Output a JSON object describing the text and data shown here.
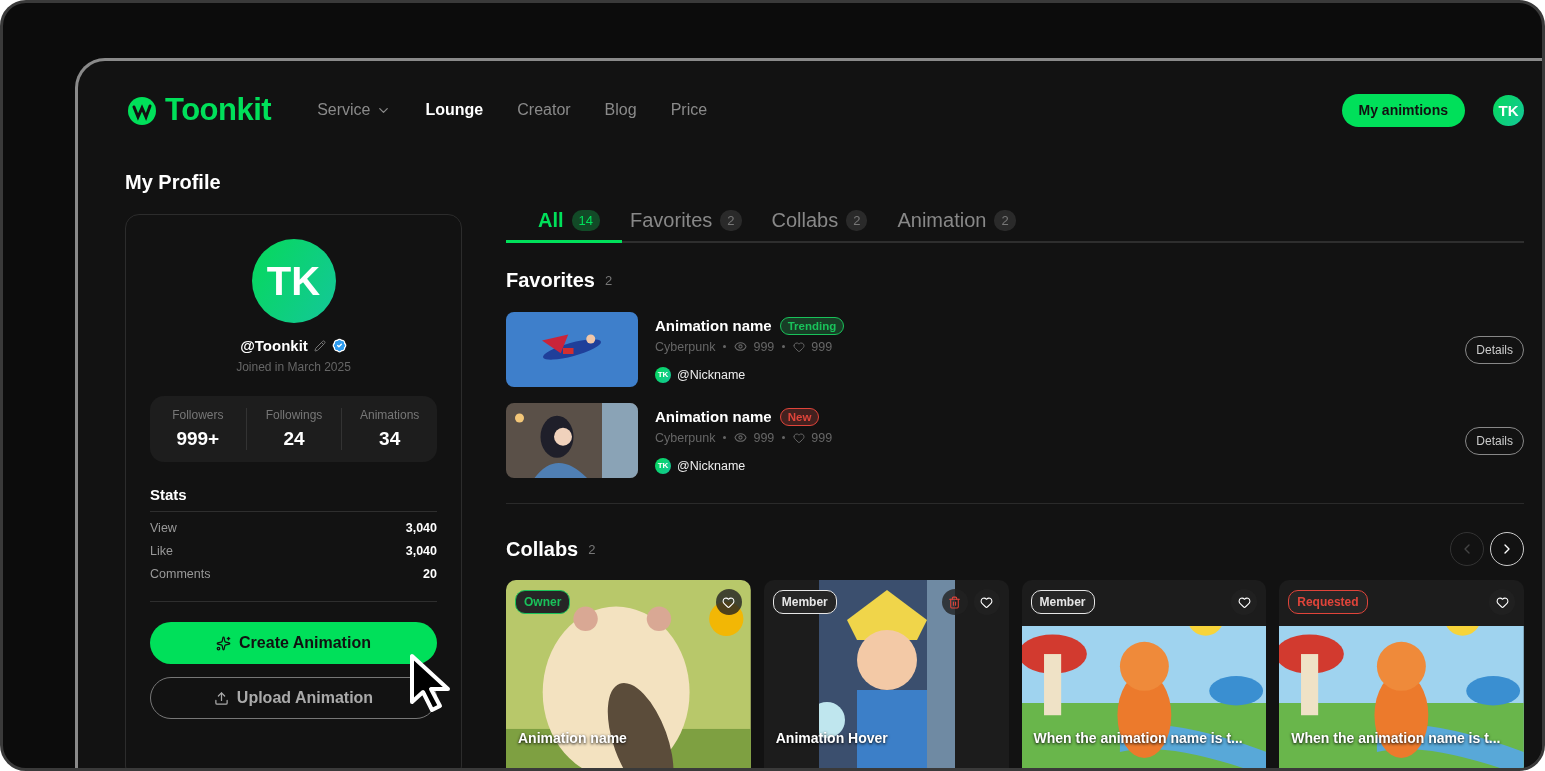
{
  "header": {
    "logo": "Toonkit",
    "nav": [
      {
        "label": "Service",
        "selected": false,
        "dropdown": true
      },
      {
        "label": "Lounge",
        "selected": true,
        "dropdown": false
      },
      {
        "label": "Creator",
        "selected": false,
        "dropdown": false
      },
      {
        "label": "Blog",
        "selected": false,
        "dropdown": false
      },
      {
        "label": "Price",
        "selected": false,
        "dropdown": false
      }
    ],
    "cta": "My animtions",
    "avatar": "TK"
  },
  "page_title": "My Profile",
  "profile": {
    "avatar": "TK",
    "handle": "@Toonkit",
    "verified": true,
    "joined": "Joined in March 2025",
    "counts": [
      {
        "label": "Followers",
        "value": "999+"
      },
      {
        "label": "Followings",
        "value": "24"
      },
      {
        "label": "Animations",
        "value": "34"
      }
    ],
    "stats_title": "Stats",
    "stats": [
      {
        "label": "View",
        "value": "3,040"
      },
      {
        "label": "Like",
        "value": "3,040"
      },
      {
        "label": "Comments",
        "value": "20"
      }
    ],
    "create_button": "Create Animation",
    "upload_button": "Upload Animation"
  },
  "tabs": [
    {
      "label": "All",
      "count": "14",
      "selected": true
    },
    {
      "label": "Favorites",
      "count": "2",
      "selected": false
    },
    {
      "label": "Collabs",
      "count": "2",
      "selected": false
    },
    {
      "label": "Animation",
      "count": "2",
      "selected": false
    }
  ],
  "favorites": {
    "title": "Favorites",
    "count": "2",
    "items": [
      {
        "name": "Animation name",
        "badge": "Trending",
        "color": "#19c25a",
        "genre": "Cyberpunk",
        "views": "999",
        "likes": "999",
        "avatar": "TK",
        "author": "@Nickname",
        "button": "Details"
      },
      {
        "name": "Animation name",
        "badge": "New",
        "color": "#e0443a",
        "genre": "Cyberpunk",
        "views": "999",
        "likes": "999",
        "avatar": "TK",
        "author": "@Nickname",
        "button": "Details"
      }
    ]
  },
  "collabs": {
    "title": "Collabs",
    "count": "2",
    "prev_disabled": true,
    "next_disabled": false,
    "cards": [
      {
        "kind": "full",
        "tag": "Owner",
        "color": "#19c25a",
        "deletable": false,
        "title": "Animation name"
      },
      {
        "kind": "hover",
        "tag": "Member",
        "color": "#e6e6e6",
        "deletable": true,
        "title": "Animation Hover"
      },
      {
        "kind": "framed",
        "tag": "Member",
        "color": "#e6e6e6",
        "deletable": false,
        "title": "When the animation name is t..."
      },
      {
        "kind": "framed",
        "tag": "Requested",
        "color": "#e0443a",
        "deletable": false,
        "title": "When the animation name is t..."
      }
    ]
  }
}
